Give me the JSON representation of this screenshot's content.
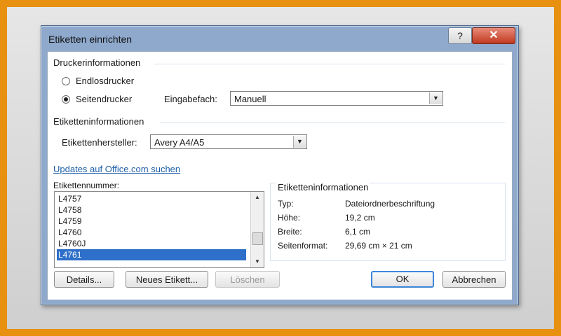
{
  "window": {
    "title": "Etiketten einrichten",
    "help_glyph": "?",
    "close_glyph": "✕"
  },
  "printer": {
    "group_label": "Druckerinformationen",
    "endless_label": "Endlosdrucker",
    "page_label": "Seitendrucker",
    "selected": "Seitendrucker",
    "tray_label": "Eingabefach:",
    "tray_value": "Manuell"
  },
  "labelinfo": {
    "group_label": "Etiketteninformationen",
    "vendor_label": "Etikettenhersteller:",
    "vendor_value": "Avery A4/A5",
    "updates_link": "Updates auf Office.com suchen"
  },
  "product": {
    "list_label": "Etikettennummer:",
    "items": [
      "L4757",
      "L4758",
      "L4759",
      "L4760",
      "L4760J",
      "L4761"
    ],
    "selected": "L4761"
  },
  "details_panel": {
    "title": "Etiketteninformationen",
    "type_key": "Typ:",
    "type_val": "Dateiordnerbeschriftung",
    "height_key": "Höhe:",
    "height_val": "19,2 cm",
    "width_key": "Breite:",
    "width_val": "6,1 cm",
    "page_key": "Seitenformat:",
    "page_val": "29,69 cm × 21 cm"
  },
  "buttons": {
    "details": "Details...",
    "new_label": "Neues Etikett...",
    "delete": "Löschen",
    "ok": "OK",
    "cancel": "Abbrechen"
  },
  "icons": {
    "dropdown": "chevron-down-icon",
    "scroll_up": "scroll-up-icon",
    "scroll_down": "scroll-down-icon"
  },
  "colors": {
    "frame": "#e8900f",
    "title_bar": "#8ea9cc",
    "close": "#c1391f",
    "selection": "#2e6fc9",
    "link": "#1f5fa8"
  }
}
